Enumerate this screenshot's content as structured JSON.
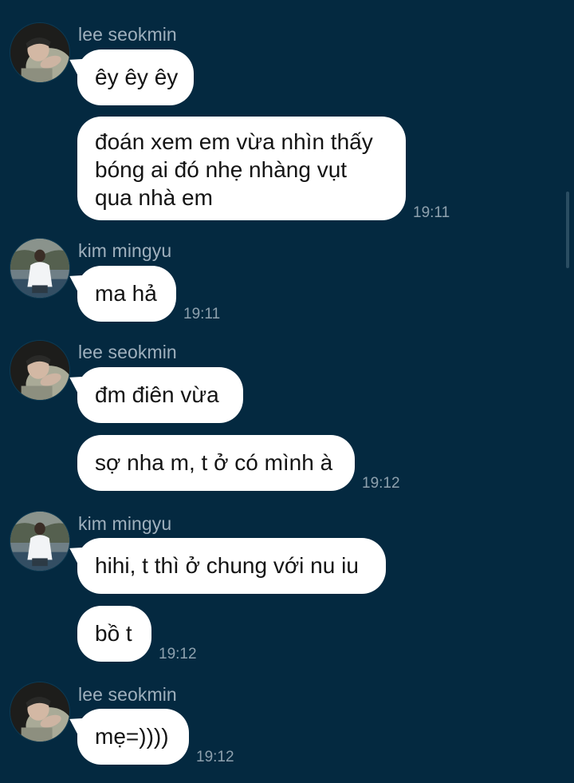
{
  "colors": {
    "background": "#042940",
    "bubble": "#ffffff",
    "sender_name": "#9fb0bd",
    "timestamp": "#8ea1ae"
  },
  "messages": [
    {
      "sender": "lee seokmin",
      "avatar": "avatar-lee-seokmin",
      "text": "êy êy êy",
      "time": ""
    },
    {
      "sender": "",
      "avatar": "",
      "text": "đoán xem em vừa nhìn thấy bóng ai đó nhẹ nhàng vụt qua nhà em",
      "time": "19:11"
    },
    {
      "sender": "kim mingyu",
      "avatar": "avatar-kim-mingyu",
      "text": "ma hả",
      "time": "19:11"
    },
    {
      "sender": "lee seokmin",
      "avatar": "avatar-lee-seokmin",
      "text": "đm điên vừa",
      "time": ""
    },
    {
      "sender": "",
      "avatar": "",
      "text": "sợ nha m, t ở có mình à",
      "time": "19:12"
    },
    {
      "sender": "kim mingyu",
      "avatar": "avatar-kim-mingyu",
      "text": "hihi, t thì ở chung với nu iu",
      "time": ""
    },
    {
      "sender": "",
      "avatar": "",
      "text": "bồ t",
      "time": "19:12"
    },
    {
      "sender": "lee seokmin",
      "avatar": "avatar-lee-seokmin",
      "text": "mẹ=))))",
      "time": "19:12"
    }
  ]
}
